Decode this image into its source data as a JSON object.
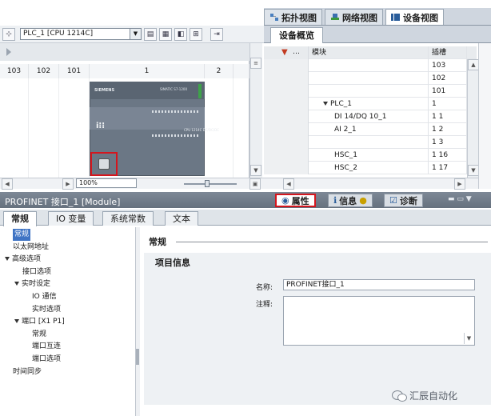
{
  "view_tabs": [
    {
      "label": "拓扑视图",
      "icon": "topology-view-icon",
      "active": false
    },
    {
      "label": "网络视图",
      "icon": "network-view-icon",
      "active": false
    },
    {
      "label": "设备视图",
      "icon": "device-view-icon",
      "active": true
    }
  ],
  "toolbar": {
    "device_select": "PLC_1 [CPU 1214C]"
  },
  "rack": {
    "slots": [
      "103",
      "102",
      "101",
      "1",
      "2"
    ],
    "plc_brand": "SIEMENS",
    "plc_model": "SIMATIC S7-1200",
    "plc_small_label": "CPU 1214C DC/DC/DC",
    "zoom": "100%"
  },
  "overview": {
    "tab_label": "设备概览",
    "col_module": "模块",
    "col_slot": "插槽",
    "rows": [
      {
        "module": "",
        "slot": "103",
        "indent": 0,
        "expand": false
      },
      {
        "module": "",
        "slot": "102",
        "indent": 0,
        "expand": false
      },
      {
        "module": "",
        "slot": "101",
        "indent": 0,
        "expand": false
      },
      {
        "module": "PLC_1",
        "slot": "1",
        "indent": 1,
        "expand": true
      },
      {
        "module": "DI 14/DQ 10_1",
        "slot": "1 1",
        "indent": 2,
        "expand": false
      },
      {
        "module": "AI 2_1",
        "slot": "1 2",
        "indent": 2,
        "expand": false
      },
      {
        "module": "",
        "slot": "1 3",
        "indent": 2,
        "expand": false
      },
      {
        "module": "HSC_1",
        "slot": "1 16",
        "indent": 2,
        "expand": false
      },
      {
        "module": "HSC_2",
        "slot": "1 17",
        "indent": 2,
        "expand": false
      }
    ]
  },
  "properties": {
    "title": "PROFINET 接口_1 [Module]",
    "tabs": [
      {
        "label": "属性",
        "icon": "properties-icon"
      },
      {
        "label": "信息",
        "icon": "info-icon"
      },
      {
        "label": "诊断",
        "icon": "diagnostics-icon"
      }
    ],
    "sub_tabs": [
      "常规",
      "IO 变量",
      "系统常数",
      "文本"
    ],
    "tree": [
      {
        "label": "常规",
        "level": 0,
        "expand": false,
        "selected": true
      },
      {
        "label": "以太网地址",
        "level": 0,
        "expand": false,
        "selected": false
      },
      {
        "label": "高级选项",
        "level": 0,
        "expand": true,
        "selected": false
      },
      {
        "label": "接口选项",
        "level": 1,
        "expand": false,
        "selected": false
      },
      {
        "label": "实时设定",
        "level": 1,
        "expand": true,
        "selected": false
      },
      {
        "label": "IO 通信",
        "level": 2,
        "expand": false,
        "selected": false
      },
      {
        "label": "实时选项",
        "level": 2,
        "expand": false,
        "selected": false
      },
      {
        "label": "端口 [X1 P1]",
        "level": 1,
        "expand": true,
        "selected": false
      },
      {
        "label": "常规",
        "level": 2,
        "expand": false,
        "selected": false
      },
      {
        "label": "端口互连",
        "level": 2,
        "expand": false,
        "selected": false
      },
      {
        "label": "端口选项",
        "level": 2,
        "expand": false,
        "selected": false
      },
      {
        "label": "时间同步",
        "level": 0,
        "expand": false,
        "selected": false
      }
    ],
    "section_header": "常规",
    "info_header": "项目信息",
    "name_label": "名称:",
    "name_value": "PROFINET接口_1",
    "comment_label": "注释:"
  },
  "watermark": "汇辰自动化",
  "colors": {
    "highlight": "#d4161e",
    "selection": "#3f74c4",
    "titlebar": "#6f7a87"
  }
}
